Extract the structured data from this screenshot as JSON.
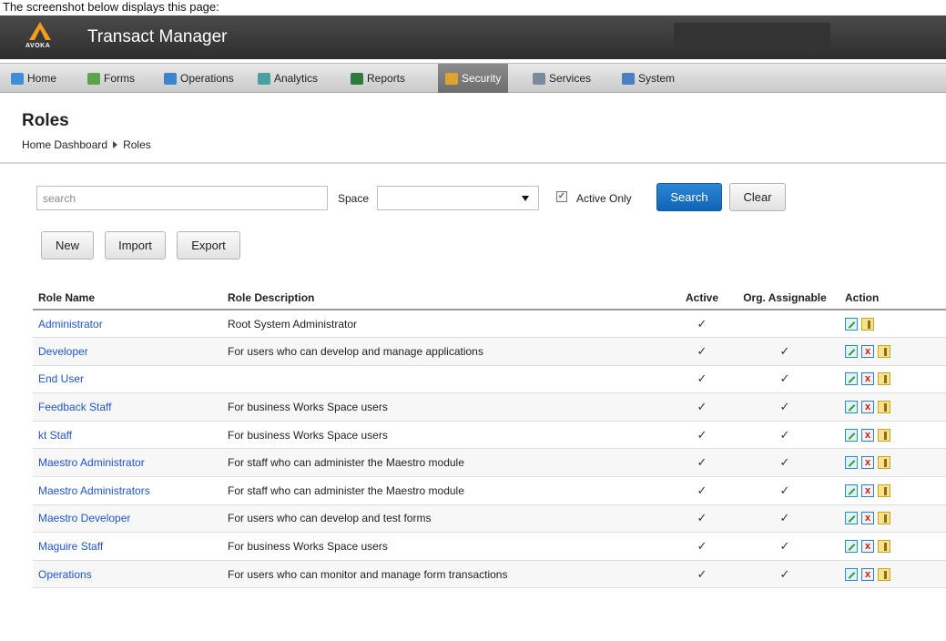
{
  "caption": "The screenshot below displays this page:",
  "app": {
    "logo_text": "AVOKA",
    "title": "Transact Manager"
  },
  "nav": {
    "items": [
      {
        "label": "Home",
        "icon": "home-icon",
        "color": "#3f8fd8"
      },
      {
        "label": "Forms",
        "icon": "forms-icon",
        "color": "#5aa54a"
      },
      {
        "label": "Operations",
        "icon": "operations-icon",
        "color": "#3e84cc"
      },
      {
        "label": "Analytics",
        "icon": "analytics-icon",
        "color": "#4aa0a0"
      },
      {
        "label": "Reports",
        "icon": "reports-icon",
        "color": "#2d7b3a"
      },
      {
        "label": "Security",
        "icon": "security-icon",
        "color": "#e0a32c"
      },
      {
        "label": "Services",
        "icon": "services-icon",
        "color": "#7a8ba0"
      },
      {
        "label": "System",
        "icon": "system-icon",
        "color": "#4a7fc0"
      }
    ],
    "active": "Security"
  },
  "page": {
    "title": "Roles",
    "breadcrumb": [
      "Home Dashboard",
      "Roles"
    ]
  },
  "filters": {
    "search_placeholder": "search",
    "search_value": "",
    "space_label": "Space",
    "space_value": "",
    "active_only_label": "Active Only",
    "active_only_checked": true,
    "search_button": "Search",
    "clear_button": "Clear"
  },
  "toolbar": {
    "new_label": "New",
    "import_label": "Import",
    "export_label": "Export"
  },
  "table": {
    "headers": {
      "name": "Role Name",
      "description": "Role Description",
      "active": "Active",
      "org": "Org. Assignable",
      "action": "Action"
    },
    "check_glyph": "✓",
    "rows": [
      {
        "name": "Administrator",
        "description": "Root System Administrator",
        "active": true,
        "org": false,
        "deletable": false
      },
      {
        "name": "Developer",
        "description": "For users who can develop and manage applications",
        "active": true,
        "org": true,
        "deletable": true
      },
      {
        "name": "End User",
        "description": "",
        "active": true,
        "org": true,
        "deletable": true
      },
      {
        "name": "Feedback Staff",
        "description": "For business Works Space users",
        "active": true,
        "org": true,
        "deletable": true
      },
      {
        "name": "kt Staff",
        "description": "For business Works Space users",
        "active": true,
        "org": true,
        "deletable": true
      },
      {
        "name": "Maestro Administrator",
        "description": "For staff who can administer the Maestro module",
        "active": true,
        "org": true,
        "deletable": true
      },
      {
        "name": "Maestro Administrators",
        "description": "For staff who can administer the Maestro module",
        "active": true,
        "org": true,
        "deletable": true
      },
      {
        "name": "Maestro Developer",
        "description": "For users who can develop and test forms",
        "active": true,
        "org": true,
        "deletable": true
      },
      {
        "name": "Maguire Staff",
        "description": "For business Works Space users",
        "active": true,
        "org": true,
        "deletable": true
      },
      {
        "name": "Operations",
        "description": "For users who can monitor and manage form transactions",
        "active": true,
        "org": true,
        "deletable": true
      }
    ]
  }
}
